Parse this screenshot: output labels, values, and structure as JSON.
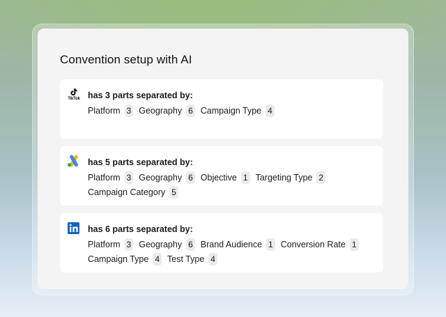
{
  "title": "Convention setup with AI",
  "cards": [
    {
      "platform_icon": "tiktok-icon",
      "logo_text": "TikTok",
      "heading": "has 3 parts separated by:",
      "parts": [
        {
          "label": "Platform",
          "count": "3"
        },
        {
          "label": "Geography",
          "count": "6"
        },
        {
          "label": "Campaign Type",
          "count": "4"
        }
      ]
    },
    {
      "platform_icon": "google-ads-icon",
      "heading": "has 5 parts separated by:",
      "parts": [
        {
          "label": "Platform",
          "count": "3"
        },
        {
          "label": "Geography",
          "count": "6"
        },
        {
          "label": "Objective",
          "count": "1"
        },
        {
          "label": "Targeting Type",
          "count": "2"
        },
        {
          "label": "Campaign Category",
          "count": "5"
        }
      ]
    },
    {
      "platform_icon": "linkedin-icon",
      "heading": "has 6 parts separated by:",
      "parts": [
        {
          "label": "Platform",
          "count": "3"
        },
        {
          "label": "Geography",
          "count": "6"
        },
        {
          "label": "Brand Audience",
          "count": "1"
        },
        {
          "label": "Conversion Rate",
          "count": "1"
        },
        {
          "label": "Campaign Type",
          "count": "4"
        },
        {
          "label": "Test Type",
          "count": "4"
        }
      ]
    }
  ],
  "colors": {
    "panel_bg": "#f4f4f4",
    "card_bg": "#ffffff",
    "badge_bg": "#ebebeb",
    "google_blue": "#4285F4",
    "google_yellow": "#FBBC04",
    "google_green": "#34A853",
    "linkedin_blue": "#0A66C2"
  }
}
